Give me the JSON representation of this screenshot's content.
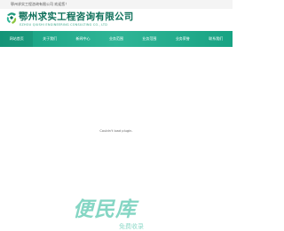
{
  "topbar": {
    "text": "鄂州求实工程咨询有限公司 欢迎您！"
  },
  "header": {
    "company_name": "鄂州求实工程咨询有限公司",
    "company_name_en": "EZHOU QIUSHI ENGINEERING CONSULTING CO., LTD",
    "logo_icon": "company-logo-icon",
    "title_color": "#0c6f59",
    "accent_color": "#3aa88a"
  },
  "nav": {
    "background": "#1aa585",
    "items": [
      {
        "label": "网站首页"
      },
      {
        "label": "关于我们"
      },
      {
        "label": "新闻中心"
      },
      {
        "label": "业务范围"
      },
      {
        "label": "业务范围"
      },
      {
        "label": "业务荣誉"
      },
      {
        "label": "联系我们"
      }
    ]
  },
  "main": {
    "plugin_message": "Couldn't load plugin."
  },
  "watermark": {
    "title": "便民库",
    "subtitle": "免费收录",
    "color": "#23b594"
  }
}
